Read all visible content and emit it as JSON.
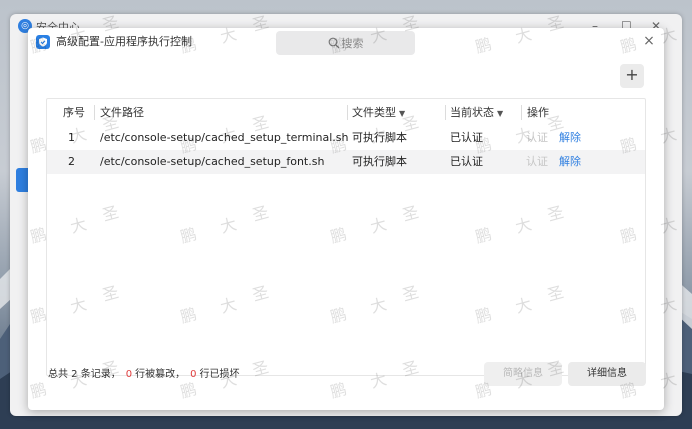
{
  "background_window": {
    "title": "安全中心",
    "controls": [
      "–",
      "☐",
      "✕"
    ]
  },
  "dialog": {
    "title": "高级配置-应用程序执行控制",
    "search_placeholder": "搜索",
    "close": "×",
    "add": "+"
  },
  "table": {
    "headers": {
      "index": "序号",
      "path": "文件路径",
      "type": "文件类型",
      "status": "当前状态",
      "action": "操作"
    },
    "rows": [
      {
        "index": "1",
        "path": "/etc/console-setup/cached_setup_terminal.sh",
        "type": "可执行脚本",
        "status": "已认证",
        "certify": "认证",
        "remove": "解除"
      },
      {
        "index": "2",
        "path": "/etc/console-setup/cached_setup_font.sh",
        "type": "可执行脚本",
        "status": "已认证",
        "certify": "认证",
        "remove": "解除"
      }
    ]
  },
  "footer": {
    "summary_prefix": "总共 2 条记录，",
    "tampered_count": "0",
    "tampered_label": "行被篡改，",
    "damaged_count": "0",
    "damaged_label": "行已损坏",
    "brief_button": "简略信息",
    "detail_button": "详细信息"
  },
  "watermark": {
    "chars": [
      "鹏",
      "大",
      "圣"
    ]
  },
  "colors": {
    "accent": "#2f7fe0",
    "danger": "#e03c3c"
  }
}
